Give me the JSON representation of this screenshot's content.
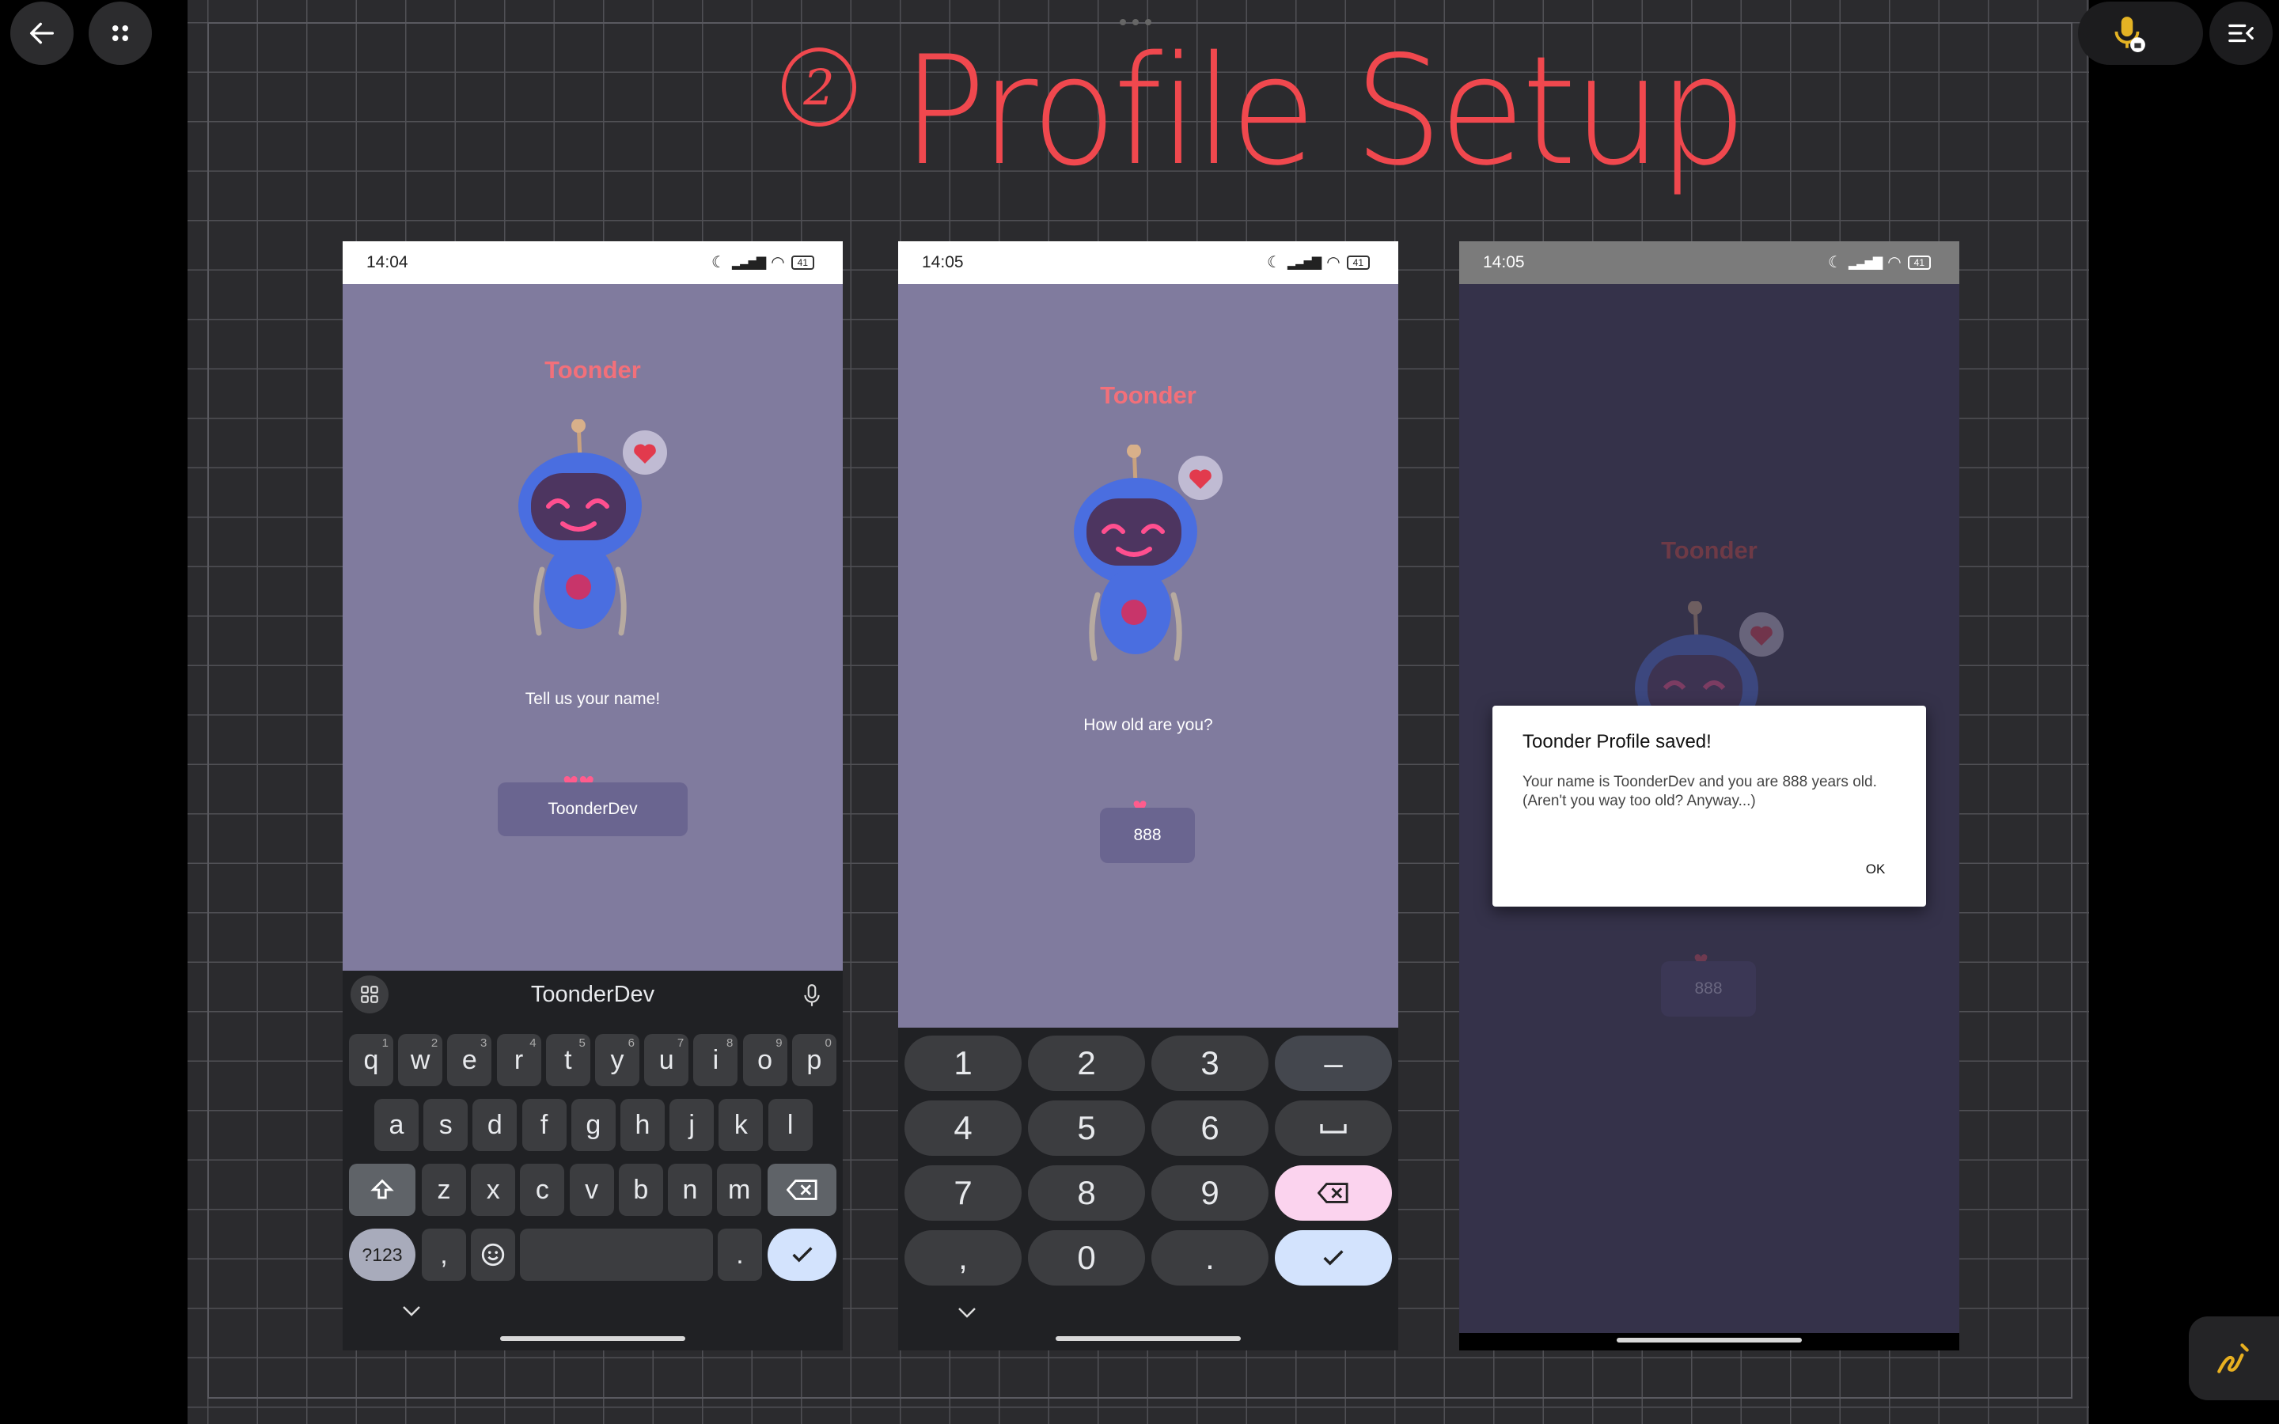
{
  "whiteboard": {
    "title_number": "2",
    "title": "Profile Setup",
    "accent_color": "#f0484e"
  },
  "toolbar": {
    "back_icon": "arrow-left-icon",
    "apps_icon": "grid-dots-icon",
    "mic_icon": "mic-locked-icon",
    "menu_icon": "menu-collapse-icon",
    "pen_icon": "pen-icon"
  },
  "phone1": {
    "time": "14:04",
    "battery": "41",
    "brand": "Toonder",
    "prompt": "Tell us your name!",
    "input_value": "ToonderDev",
    "suggestion": "ToonderDev",
    "keyboard_rows": [
      [
        "q",
        "w",
        "e",
        "r",
        "t",
        "y",
        "u",
        "i",
        "o",
        "p"
      ],
      [
        "a",
        "s",
        "d",
        "f",
        "g",
        "h",
        "j",
        "k",
        "l"
      ],
      [
        "z",
        "x",
        "c",
        "v",
        "b",
        "n",
        "m"
      ]
    ],
    "number_hints": [
      "1",
      "2",
      "3",
      "4",
      "5",
      "6",
      "7",
      "8",
      "9",
      "0"
    ],
    "symbols_key": "?123",
    "comma_key": ",",
    "period_key": "."
  },
  "phone2": {
    "time": "14:05",
    "battery": "41",
    "brand": "Toonder",
    "prompt": "How old are you?",
    "input_value": "888",
    "numpad": [
      [
        "1",
        "2",
        "3",
        "–"
      ],
      [
        "4",
        "5",
        "6",
        "␣"
      ],
      [
        "7",
        "8",
        "9",
        "⌫"
      ],
      [
        ",",
        "0",
        ".",
        "✓"
      ]
    ]
  },
  "phone3": {
    "time": "14:05",
    "battery": "41",
    "brand": "Toonder",
    "input_value": "888",
    "dialog": {
      "title": "Toonder Profile saved!",
      "message": "Your name is ToonderDev and you are 888 years old. (Aren't you way too old? Anyway...)",
      "ok_label": "OK"
    }
  }
}
